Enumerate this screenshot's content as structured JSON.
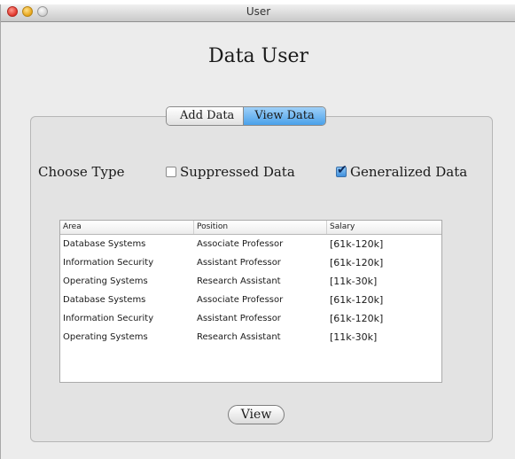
{
  "window": {
    "title": "User"
  },
  "page": {
    "title": "Data User"
  },
  "tabs": [
    {
      "label": "Add Data",
      "active": false
    },
    {
      "label": "View Data",
      "active": true
    }
  ],
  "filter": {
    "label": "Choose Type",
    "options": [
      {
        "label": "Suppressed Data",
        "checked": false
      },
      {
        "label": "Generalized Data",
        "checked": true
      }
    ]
  },
  "table": {
    "columns": [
      "Area",
      "Position",
      "Salary"
    ],
    "rows": [
      [
        "Database Systems",
        "Associate Professor",
        "[61k-120k]"
      ],
      [
        "Information Security",
        "Assistant Professor",
        "[61k-120k]"
      ],
      [
        "Operating Systems",
        "Research Assistant",
        "[11k-30k]"
      ],
      [
        "Database Systems",
        "Associate Professor",
        "[61k-120k]"
      ],
      [
        "Information Security",
        "Assistant Professor",
        "[61k-120k]"
      ],
      [
        "Operating Systems",
        "Research Assistant",
        "[11k-30k]"
      ]
    ]
  },
  "buttons": {
    "view": "View"
  },
  "colors": {
    "tab_active": "#4aa1ea",
    "window_bg": "#ececec"
  }
}
